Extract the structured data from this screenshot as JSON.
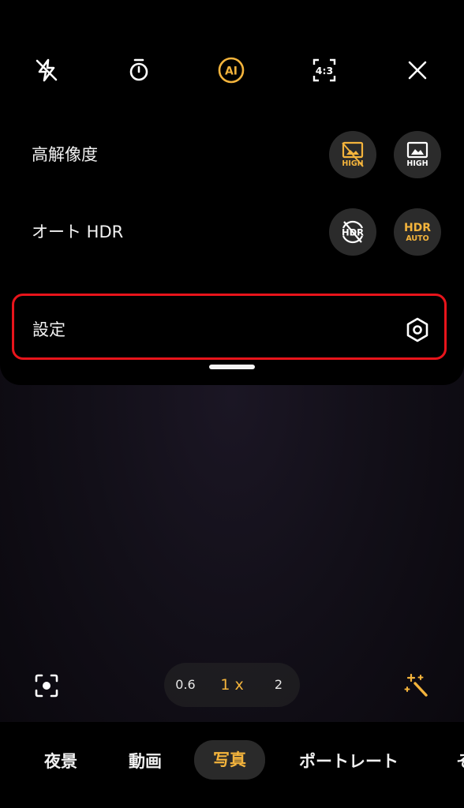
{
  "top_bar": {
    "icons": [
      "flash-off-icon",
      "timer-icon",
      "ai-icon",
      "aspect-ratio-icon",
      "close-icon"
    ],
    "ai_label": "AI",
    "aspect_label": "4:3",
    "accent_color": "#f4b43c"
  },
  "options": {
    "high_res": {
      "label": "高解像度",
      "off_badge": "HIGH",
      "on_badge": "HIGH",
      "selected": "off"
    },
    "auto_hdr": {
      "label": "オート HDR",
      "off_badge": "HDR",
      "on_badge_top": "HDR",
      "on_badge_bottom": "AUTO",
      "selected": "auto"
    },
    "settings": {
      "label": "設定",
      "highlight_color": "#e8141b"
    }
  },
  "zoom": {
    "levels": [
      "0.6",
      "1 x",
      "2"
    ],
    "selected": "1 x"
  },
  "modes": {
    "items": [
      "夜景",
      "動画",
      "写真",
      "ポートレート",
      "そ"
    ],
    "selected": "写真"
  }
}
